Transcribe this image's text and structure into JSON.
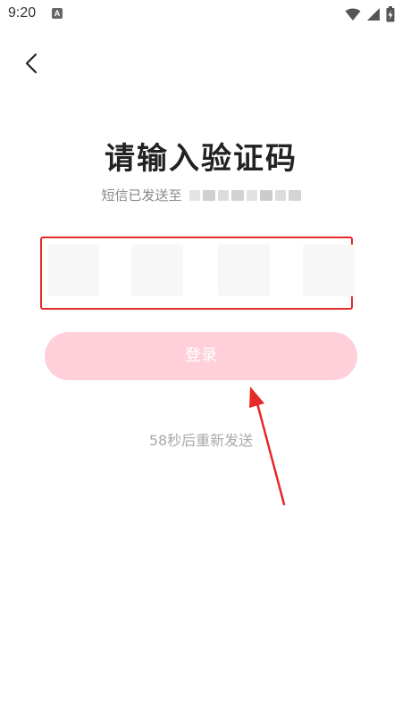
{
  "status_bar": {
    "time": "9:20",
    "app_icon_label": "A",
    "icons": [
      "wifi-icon",
      "signal-icon",
      "battery-icon"
    ]
  },
  "nav": {
    "back_icon": "chevron-left-icon"
  },
  "page": {
    "title": "请输入验证码",
    "subtitle": "短信已发送至"
  },
  "code_input": {
    "length": 4,
    "values": [
      "",
      "",
      "",
      ""
    ]
  },
  "login_button": {
    "label": "登录",
    "color": "#ffd0da"
  },
  "resend": {
    "text": "58秒后重新发送"
  },
  "annotation": {
    "highlight_color": "#e62929"
  }
}
